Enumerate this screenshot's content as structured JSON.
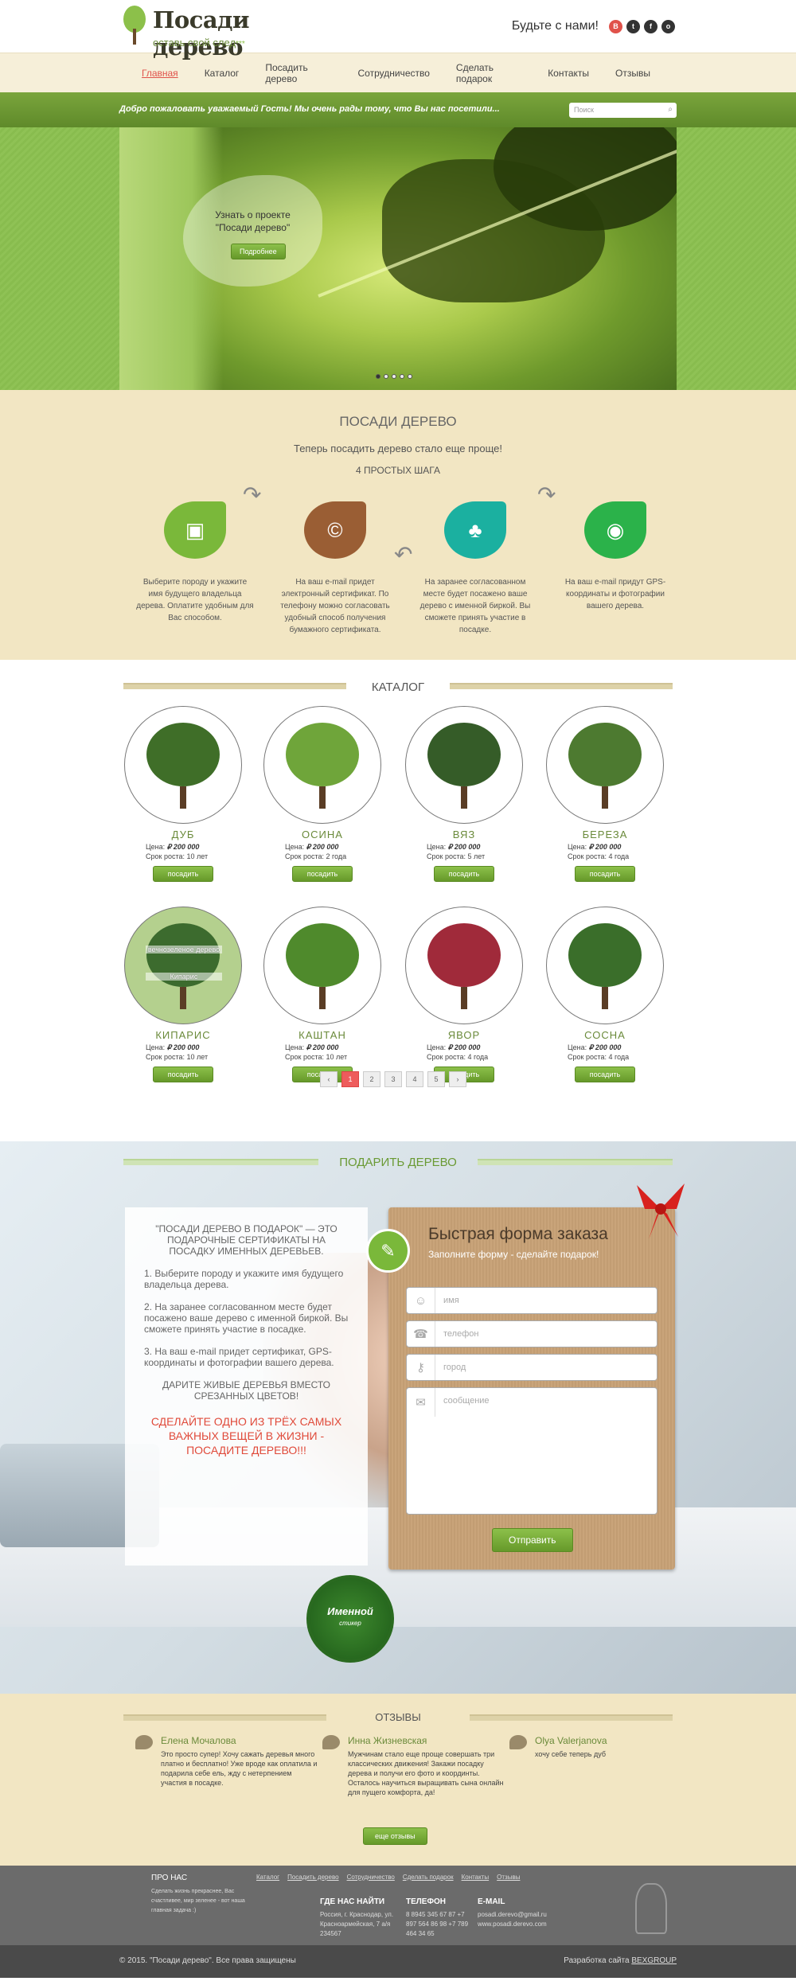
{
  "header": {
    "logo_title": "Посади дерево",
    "logo_tagline": "оставь свой след",
    "logo_dots": "***",
    "social_label": "Будьте с нами!",
    "social": [
      {
        "icon": "vk-icon",
        "glyph": "В",
        "color": "#e0524a"
      },
      {
        "icon": "twitter-icon",
        "glyph": "t",
        "color": "#333"
      },
      {
        "icon": "facebook-icon",
        "glyph": "f",
        "color": "#333"
      },
      {
        "icon": "odnoklassniki-icon",
        "glyph": "о",
        "color": "#333"
      }
    ]
  },
  "nav": [
    "Главная",
    "Каталог",
    "Посадить дерево",
    "Сотрудничество",
    "Сделать подарок",
    "Контакты",
    "Отзывы"
  ],
  "welcome": {
    "text": "Добро пожаловать уважаемый Гость! Мы очень рады тому, что Вы нас посетили...",
    "search_placeholder": "Поиск"
  },
  "slider": {
    "line1": "Узнать о проекте",
    "line2": "\"Посади дерево\"",
    "button": "Подробнее",
    "slides": 5,
    "active": 1
  },
  "steps": {
    "title": "ПОСАДИ ДЕРЕВО",
    "subtitle": "Теперь посадить дерево стало еще проще!",
    "count": "4 ПРОСТЫХ ШАГА",
    "items": [
      {
        "icon": "wallet-icon",
        "glyph": "▣",
        "color": "#7ab83a",
        "text": "Выберите породу и укажите имя будущего владельца дерева. Оплатите удобным для Вас способом."
      },
      {
        "icon": "certificate-icon",
        "glyph": "©",
        "color": "#9a5e34",
        "text": "На ваш e-mail придет электронный сертификат. По телефону можно согласовать удобный способ получения бумажного сертификата."
      },
      {
        "icon": "trees-icon",
        "glyph": "♣",
        "color": "#1bb0a0",
        "text": "На заранее согласованном месте будет посажено ваше дерево с именной биркой. Вы сможете принять участие в посадке."
      },
      {
        "icon": "camera-icon",
        "glyph": "◉",
        "color": "#2bb24a",
        "text": "На ваш e-mail придут GPS-координаты и фотографии вашего дерева."
      }
    ]
  },
  "catalog": {
    "title": "КАТАЛОГ",
    "price_label": "Цена:",
    "term_label": "Срок роста:",
    "button": "посадить",
    "overlay1": "вечнозеленое дерево",
    "overlay2": "Кипарис",
    "trees": [
      {
        "name": "ДУБ",
        "price": "₽ 200 000",
        "term": "10 лет",
        "color": "#3f6e28"
      },
      {
        "name": "ОСИНА",
        "price": "₽ 200 000",
        "term": "2 года",
        "color": "#6fa53a"
      },
      {
        "name": "ВЯЗ",
        "price": "₽ 200 000",
        "term": "5 лет",
        "color": "#355c28"
      },
      {
        "name": "БЕРЕЗА",
        "price": "₽ 200 000",
        "term": "4 года",
        "color": "#4d7a30"
      },
      {
        "name": "КИПАРИС",
        "price": "₽ 200 000",
        "term": "10 лет",
        "color": "#3c6b2e"
      },
      {
        "name": "КАШТАН",
        "price": "₽ 200 000",
        "term": "10 лет",
        "color": "#4f8a2c"
      },
      {
        "name": "ЯВОР",
        "price": "₽ 200 000",
        "term": "4 года",
        "color": "#a02a3a"
      },
      {
        "name": "СОСНА",
        "price": "₽ 200 000",
        "term": "4 года",
        "color": "#3a6e2a"
      }
    ],
    "pager": [
      "‹",
      "1",
      "2",
      "3",
      "4",
      "5",
      "›"
    ]
  },
  "gift": {
    "title": "ПОДАРИТЬ ДЕРЕВО",
    "intro": "\"ПОСАДИ ДЕРЕВО В ПОДАРОК\" — ЭТО ПОДАРОЧНЫЕ СЕРТИФИКАТЫ НА ПОСАДКУ ИМЕННЫХ ДЕРЕВЬЕВ.",
    "p1": "1. Выберите породу и укажите имя будущего владельца дерева.",
    "p2": "2. На заранее согласованном месте будет посажено ваше дерево с именной биркой. Вы сможете принять участие в посадке.",
    "p3": "3. На ваш e-mail придет сертификат, GPS-координаты и фотографии вашего дерева.",
    "motto": "ДАРИТЕ ЖИВЫЕ ДЕРЕВЬЯ ВМЕСТО СРЕЗАННЫХ ЦВЕТОВ!",
    "red1": "СДЕЛАЙТЕ ОДНО ИЗ ТРЁХ САМЫХ ВАЖНЫХ ВЕЩЕЙ В ЖИЗНИ -",
    "red2": "ПОСАДИТЕ ДЕРЕВО!!!",
    "form_title": "Быстрая форма заказа",
    "form_sub": "Заполните форму - сделайте подарок!",
    "f_name": "имя",
    "f_phone": "телефон",
    "f_city": "город",
    "f_msg": "сообщение",
    "submit": "Отправить",
    "sticker1": "Именной",
    "sticker2": "стикер"
  },
  "reviews": {
    "title": "ОТЗЫВЫ",
    "items": [
      {
        "name": "Елена Мочалова",
        "text": "Это просто супер! Хочу сажать деревья много платно и бесплатно! Уже вроде как оплатила и подарила себе ель, жду с нетерпением участия в посадке."
      },
      {
        "name": "Инна Жизневская",
        "text": "Мужчинам стало еще проще совершать три классических движения! Закажи посадку дерева и получи его фото и координты. Осталось научиться выращивать сына онлайн для пущего комфорта, да!"
      },
      {
        "name": "Olya Valerjanova",
        "text": "хочу себе теперь дуб"
      }
    ],
    "button": "еще отзывы"
  },
  "footer": {
    "about_title": "ПРО НАС",
    "about": "Сделать жизнь прекраснее, Вас счастливее, мир зеленее - вот наша главная задача :)",
    "links": [
      "Каталог",
      "Посадить дерево",
      "Сотрудничество",
      "Сделать подарок",
      "Контакты",
      "Отзывы"
    ],
    "addr_title": "ГДЕ НАС НАЙТИ",
    "addr": "Россия, г. Краснодар, ул. Красноармейская, 7 а/я 234567",
    "tel_title": "ТЕЛЕФОН",
    "tel": "8 8945 345 67 87 +7 897 564 86 98 +7 789 464 34 65",
    "mail_title": "E-MAIL",
    "mail": "posadi.derevo@gmail.ru www.posadi.derevo.com",
    "copyright": "© 2015. \"Посади дерево\". Все права защищены",
    "dev_label": "Разработка сайта",
    "dev": "BEXGROUP"
  }
}
